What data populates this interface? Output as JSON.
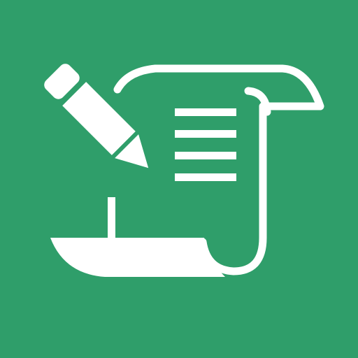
{
  "icon": {
    "name": "scroll-with-pencil-icon",
    "colors": {
      "background": "#2f9e6a",
      "foreground": "#ffffff"
    }
  }
}
